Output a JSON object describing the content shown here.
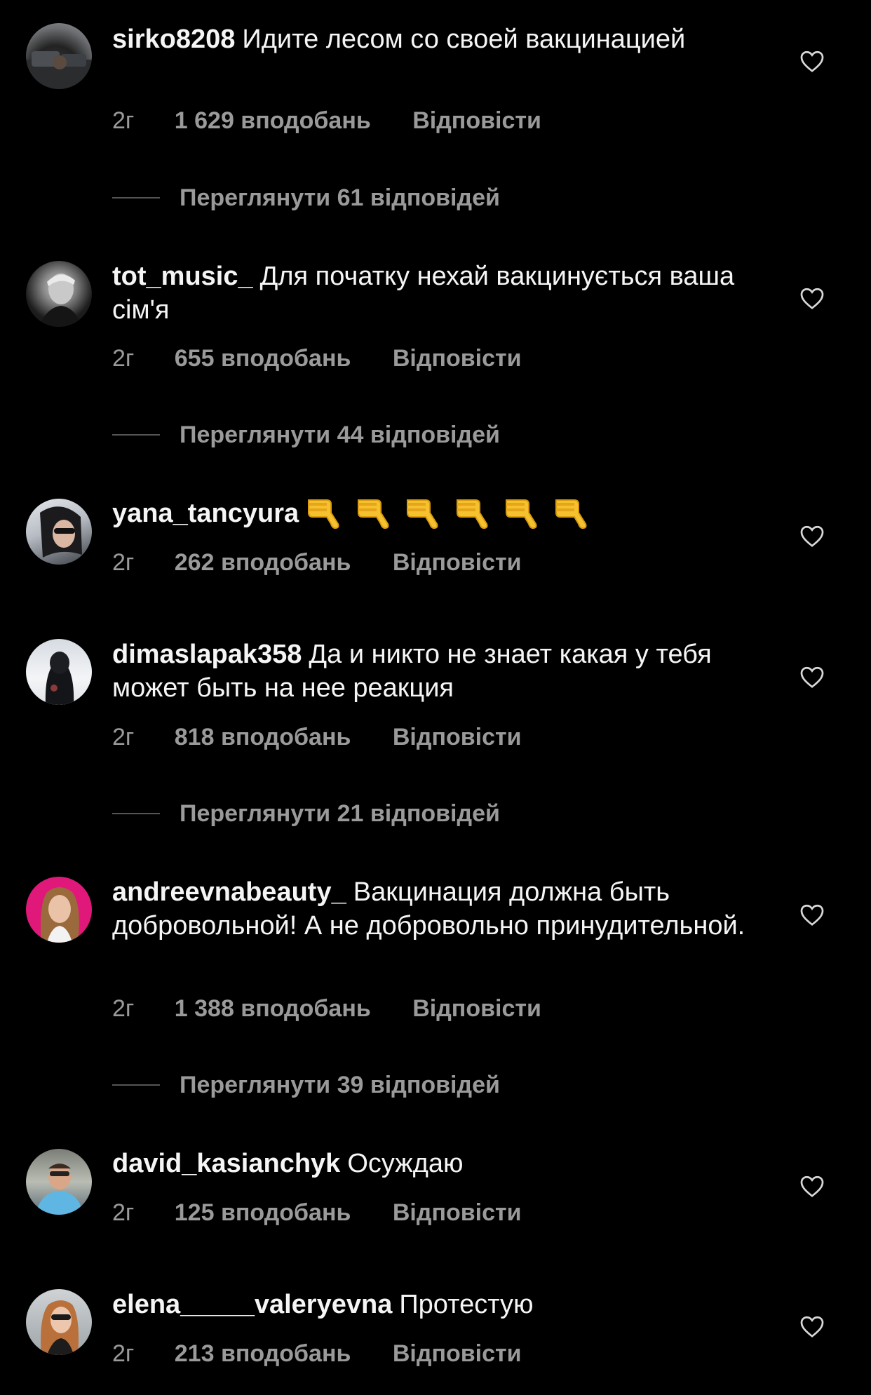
{
  "comments": [
    {
      "username": "sirko8208",
      "text": "Идите лесом со своей вакцинацией",
      "time": "2г",
      "likes": "1 629 вподобань",
      "reply_label": "Відповісти",
      "view_replies": "Переглянути 61 відповідей",
      "avatar_icon": "avatar-photo"
    },
    {
      "username": "tot_music_",
      "text": "Для початку нехай вакцинується ваша сім'я",
      "time": "2г",
      "likes": "655 вподобань",
      "reply_label": "Відповісти",
      "view_replies": "Переглянути 44 відповідей",
      "avatar_icon": "avatar-photo"
    },
    {
      "username": "yana_tancyura",
      "text": "",
      "emoji": "thumbs-down-icon x6",
      "time": "2г",
      "likes": "262 вподобань",
      "reply_label": "Відповісти",
      "avatar_icon": "avatar-photo"
    },
    {
      "username": "dimaslapak358",
      "text": "Да и никто не знает какая у тебя может быть на нее реакция",
      "time": "2г",
      "likes": "818 вподобань",
      "reply_label": "Відповісти",
      "view_replies": "Переглянути 21 відповідей",
      "avatar_icon": "avatar-photo"
    },
    {
      "username": "andreevnabeauty_",
      "text": "Вакцинация должна быть добровольной! А не добровольно принудительной.",
      "time": "2г",
      "likes": "1 388 вподобань",
      "reply_label": "Відповісти",
      "view_replies": "Переглянути 39 відповідей",
      "avatar_icon": "avatar-photo"
    },
    {
      "username": "david_kasianchyk",
      "text": "Осуждаю",
      "time": "2г",
      "likes": "125 вподобань",
      "reply_label": "Відповісти",
      "avatar_icon": "avatar-photo"
    },
    {
      "username": "elena_____valeryevna",
      "text": "Протестую",
      "time": "2г",
      "likes": "213 вподобань",
      "reply_label": "Відповісти",
      "avatar_icon": "avatar-photo"
    }
  ],
  "colors": {
    "background": "#000000",
    "text": "#f5f5f5",
    "secondary": "#9a9a9a"
  }
}
